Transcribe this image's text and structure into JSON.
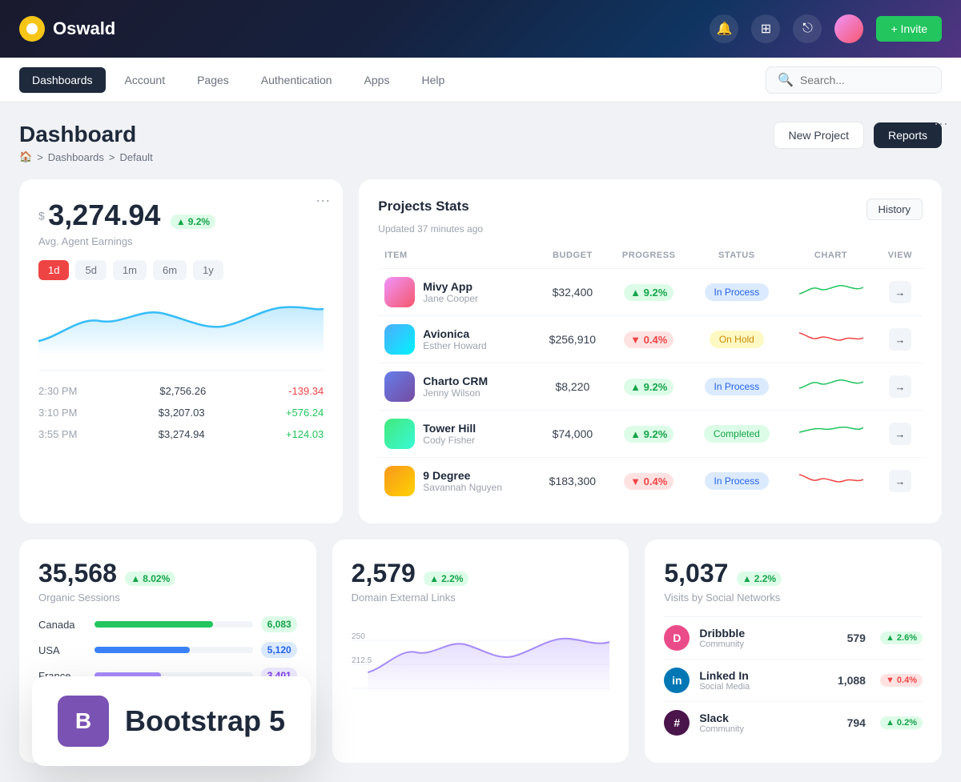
{
  "topnav": {
    "logo_text": "Oswald",
    "invite_label": "+ Invite"
  },
  "secnav": {
    "tabs": [
      {
        "label": "Dashboards",
        "active": true
      },
      {
        "label": "Account",
        "active": false
      },
      {
        "label": "Pages",
        "active": false
      },
      {
        "label": "Authentication",
        "active": false
      },
      {
        "label": "Apps",
        "active": false
      },
      {
        "label": "Help",
        "active": false
      }
    ],
    "search_placeholder": "Search..."
  },
  "page": {
    "title": "Dashboard",
    "breadcrumb": [
      "Dashboards",
      "Default"
    ],
    "btn_new_project": "New Project",
    "btn_reports": "Reports"
  },
  "earnings_card": {
    "currency": "$",
    "value": "3,274.94",
    "badge": "9.2%",
    "label": "Avg. Agent Earnings",
    "time_filters": [
      "1d",
      "5d",
      "1m",
      "6m",
      "1y"
    ],
    "active_filter": "1d",
    "rows": [
      {
        "time": "2:30 PM",
        "amount": "$2,756.26",
        "change": "-139.34",
        "sign": "neg"
      },
      {
        "time": "3:10 PM",
        "amount": "$3,207.03",
        "change": "+576.24",
        "sign": "pos"
      },
      {
        "time": "3:55 PM",
        "amount": "$3,274.94",
        "change": "+124.03",
        "sign": "pos"
      }
    ]
  },
  "projects_card": {
    "title": "Projects Stats",
    "updated": "Updated 37 minutes ago",
    "history_btn": "History",
    "columns": [
      "Item",
      "Budget",
      "Progress",
      "Status",
      "Chart",
      "View"
    ],
    "rows": [
      {
        "name": "Mivy App",
        "sub": "Jane Cooper",
        "budget": "$32,400",
        "progress": "9.2%",
        "progress_dir": "up",
        "status": "In Process",
        "status_type": "inprocess",
        "thumb": "1"
      },
      {
        "name": "Avionica",
        "sub": "Esther Howard",
        "budget": "$256,910",
        "progress": "0.4%",
        "progress_dir": "down",
        "status": "On Hold",
        "status_type": "onhold",
        "thumb": "2"
      },
      {
        "name": "Charto CRM",
        "sub": "Jenny Wilson",
        "budget": "$8,220",
        "progress": "9.2%",
        "progress_dir": "up",
        "status": "In Process",
        "status_type": "inprocess",
        "thumb": "3"
      },
      {
        "name": "Tower Hill",
        "sub": "Cody Fisher",
        "budget": "$74,000",
        "progress": "9.2%",
        "progress_dir": "up",
        "status": "Completed",
        "status_type": "completed",
        "thumb": "4"
      },
      {
        "name": "9 Degree",
        "sub": "Savannah Nguyen",
        "budget": "$183,300",
        "progress": "0.4%",
        "progress_dir": "down",
        "status": "In Process",
        "status_type": "inprocess",
        "thumb": "5"
      }
    ]
  },
  "sessions_card": {
    "value": "35,568",
    "badge": "8.02%",
    "label": "Organic Sessions",
    "bars": [
      {
        "label": "Canada",
        "value": 6083,
        "pct": 75,
        "color": "#22c55e"
      },
      {
        "label": "USA",
        "value": 5120,
        "pct": 60,
        "color": "#3b82f6"
      },
      {
        "label": "France",
        "value": 3401,
        "pct": 42,
        "color": "#a78bfa"
      }
    ]
  },
  "domain_card": {
    "value": "2,579",
    "badge": "2.2%",
    "label": "Domain External Links"
  },
  "social_card": {
    "value": "5,037",
    "badge": "2.2%",
    "label": "Visits by Social Networks",
    "rows": [
      {
        "name": "Dribbble",
        "type": "Community",
        "count": "579",
        "badge": "2.6%",
        "dir": "up",
        "color": "#ea4c89"
      },
      {
        "name": "Linked In",
        "type": "Social Media",
        "count": "1,088",
        "badge": "0.4%",
        "dir": "down",
        "color": "#0077b5"
      },
      {
        "name": "Slack",
        "type": "Community",
        "count": "794",
        "badge": "0.2%",
        "dir": "up",
        "color": "#4a154b"
      }
    ]
  },
  "bootstrap_overlay": {
    "logo": "B",
    "text": "Bootstrap 5"
  }
}
